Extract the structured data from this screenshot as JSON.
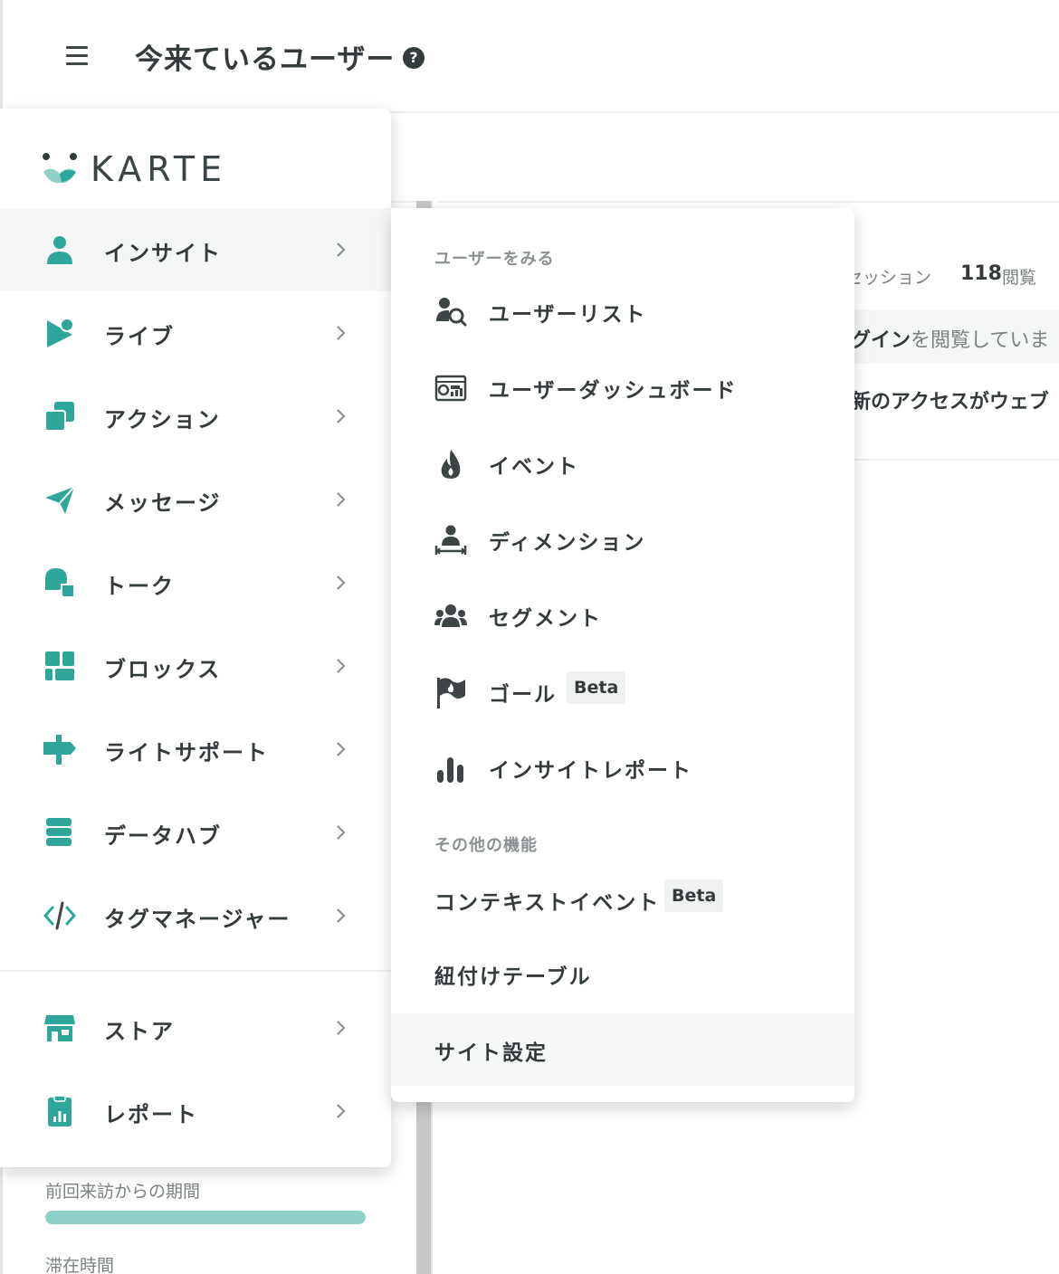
{
  "header": {
    "title": "今来ているユーザー",
    "help_glyph": "?"
  },
  "colors": {
    "accent": "#2fa69a",
    "accent_light": "#8fd0c7",
    "text": "#333b3d",
    "muted": "#8a9294"
  },
  "background": {
    "session_label": "セッション",
    "views_count": "118",
    "views_label": "閲覧",
    "row1_bold": "グイン",
    "row1_rest": "を閲覧していま",
    "row2": "新のアクセスがウェブ",
    "period_label": "前回来訪からの期間",
    "period_progress": 1.0,
    "stay_label": "滞在時間"
  },
  "sidebar": {
    "logo_text": "KARTE",
    "items": [
      {
        "label": "インサイト",
        "icon": "person-icon"
      },
      {
        "label": "ライブ",
        "icon": "live-icon"
      },
      {
        "label": "アクション",
        "icon": "action-icon"
      },
      {
        "label": "メッセージ",
        "icon": "paper-plane-icon"
      },
      {
        "label": "トーク",
        "icon": "chat-bubble-icon"
      },
      {
        "label": "ブロックス",
        "icon": "blocks-icon"
      },
      {
        "label": "ライトサポート",
        "icon": "signpost-icon"
      },
      {
        "label": "データハブ",
        "icon": "database-icon"
      },
      {
        "label": "タグマネージャー",
        "icon": "code-icon"
      },
      {
        "label": "ストア",
        "icon": "store-icon"
      },
      {
        "label": "レポート",
        "icon": "report-icon"
      }
    ]
  },
  "submenu": {
    "section_users": "ユーザーをみる",
    "section_other": "その他の機能",
    "items": [
      {
        "label": "ユーザーリスト",
        "icon": "user-search-icon"
      },
      {
        "label": "ユーザーダッシュボード",
        "icon": "dashboard-icon"
      },
      {
        "label": "イベント",
        "icon": "fire-icon"
      },
      {
        "label": "ディメンション",
        "icon": "dimension-icon"
      },
      {
        "label": "セグメント",
        "icon": "group-icon"
      },
      {
        "label": "ゴール",
        "icon": "flag-icon",
        "badge": "Beta"
      },
      {
        "label": "インサイトレポート",
        "icon": "bar-chart-icon"
      }
    ],
    "other_items": [
      {
        "label": "コンテキストイベント",
        "badge": "Beta"
      },
      {
        "label": "紐付けテーブル"
      },
      {
        "label": "サイト設定"
      }
    ]
  }
}
